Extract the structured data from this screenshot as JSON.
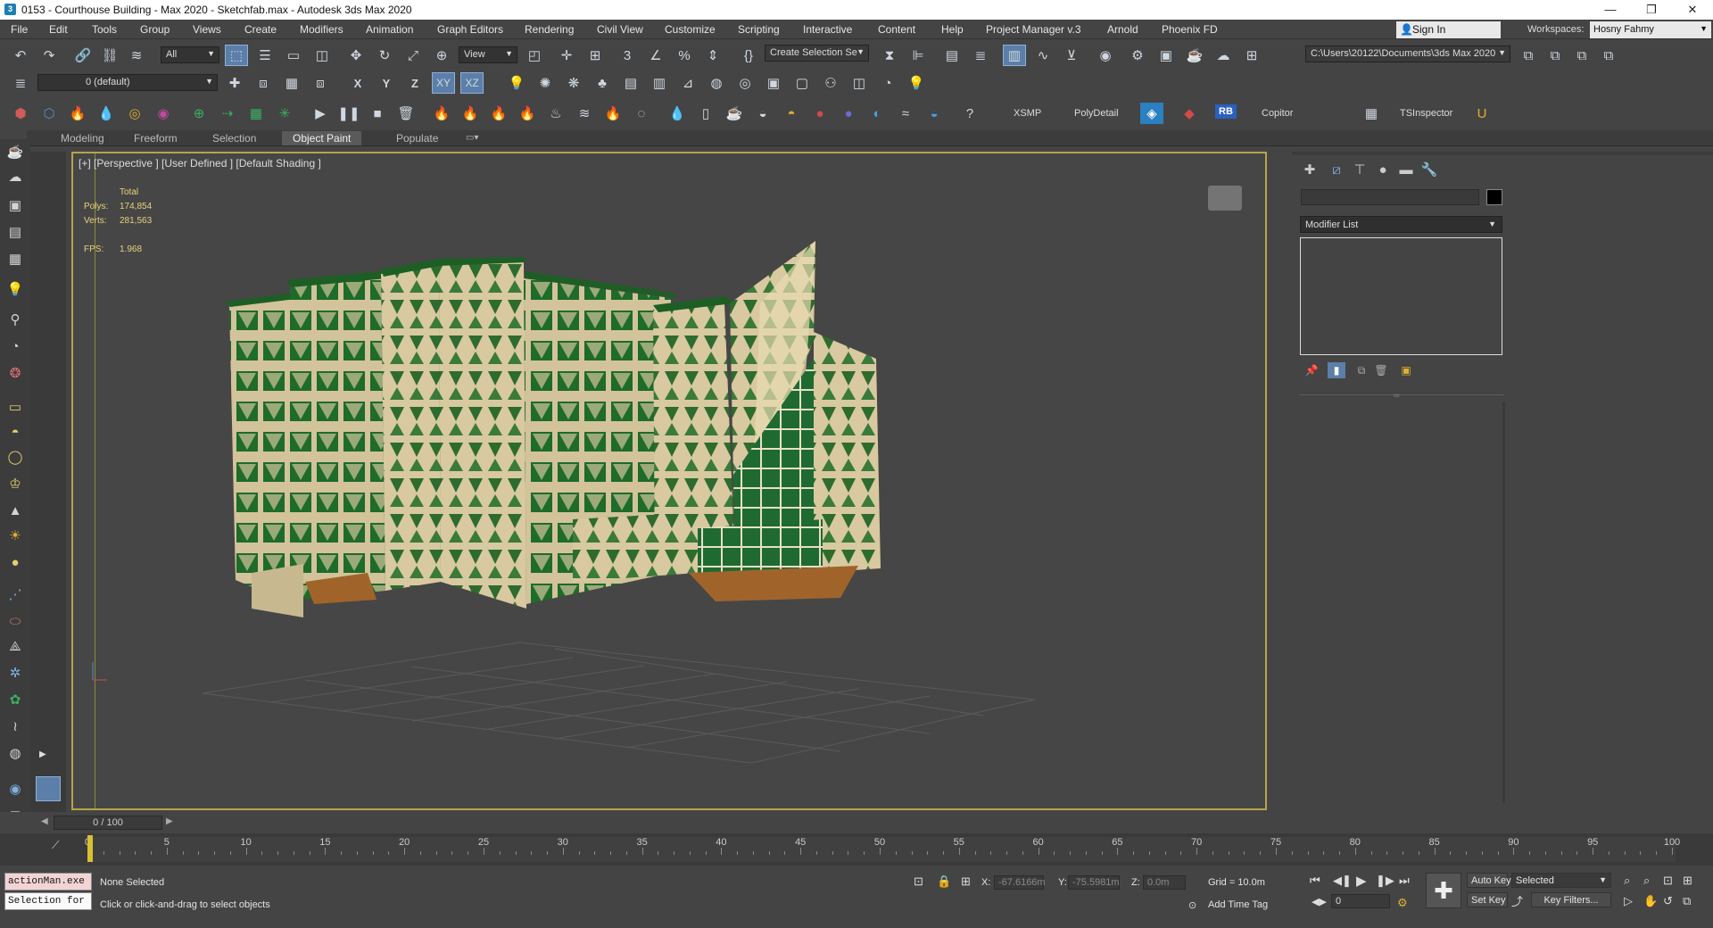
{
  "title": "0153 - Courthouse Building - Max 2020 - Sketchfab.max - Autodesk 3ds Max 2020",
  "window_controls": {
    "minimize": "—",
    "maximize": "❐",
    "close": "✕"
  },
  "menu": [
    "File",
    "Edit",
    "Tools",
    "Group",
    "Views",
    "Create",
    "Modifiers",
    "Animation",
    "Graph Editors",
    "Rendering",
    "Civil View",
    "Customize",
    "Scripting",
    "Interactive",
    "Content",
    "Help",
    "Project Manager v.3",
    "Arnold",
    "Phoenix FD"
  ],
  "account": {
    "sign_in": "Sign In",
    "workspaces_label": "Workspaces:",
    "workspace": "Hosny Fahmy"
  },
  "toolbar1": {
    "selection_filter": "All",
    "ref_coord": "View",
    "named_selection": "Create Selection Se",
    "project_path": "C:\\Users\\20122\\Documents\\3ds Max 2020"
  },
  "toolbar2": {
    "layer": "0 (default)",
    "axis": [
      "X",
      "Y",
      "Z",
      "XY",
      "XZ"
    ]
  },
  "toolbar3": {
    "plugins": [
      "XSMP",
      "PolyDetail",
      "RB",
      "Copitor",
      "TSInspector"
    ]
  },
  "ribbon_tabs": [
    "Modeling",
    "Freeform",
    "Selection",
    "Object Paint",
    "Populate"
  ],
  "active_ribbon_tab": "Object Paint",
  "viewport": {
    "label": "[+] [Perspective ] [User Defined ] [Default Shading ]",
    "stats": {
      "total_label": "Total",
      "polys_label": "Polys:",
      "polys": "174,854",
      "verts_label": "Verts:",
      "verts": "281,563",
      "fps_label": "FPS:",
      "fps": "1.968"
    }
  },
  "command_panel": {
    "modifier_list": "Modifier List"
  },
  "time_slider": {
    "value": "0 / 100"
  },
  "track_ticks": [
    "0",
    "5",
    "10",
    "15",
    "20",
    "25",
    "30",
    "35",
    "40",
    "45",
    "50",
    "55",
    "60",
    "65",
    "70",
    "75",
    "80",
    "85",
    "90",
    "95",
    "100"
  ],
  "status": {
    "maxscript_line1": "actionMan.exe",
    "maxscript_line2": "Selection for",
    "selection": "None Selected",
    "prompt": "Click or click-and-drag to select objects",
    "x_label": "X:",
    "x": "-67.6166m",
    "y_label": "Y:",
    "y": "-75.5981m",
    "z_label": "Z:",
    "z": "0.0m",
    "grid": "Grid = 10.0m",
    "add_time_tag": "Add Time Tag",
    "frame": "0",
    "auto_key": "Auto Key",
    "set_key": "Set Key",
    "key_mode": "Selected",
    "key_filters": "Key Filters..."
  },
  "colors": {
    "viewport_border": "#b8a44a",
    "building_green": "#1e6b2a",
    "facade": "#d8c9a0",
    "stats_text": "#e8d27a"
  }
}
